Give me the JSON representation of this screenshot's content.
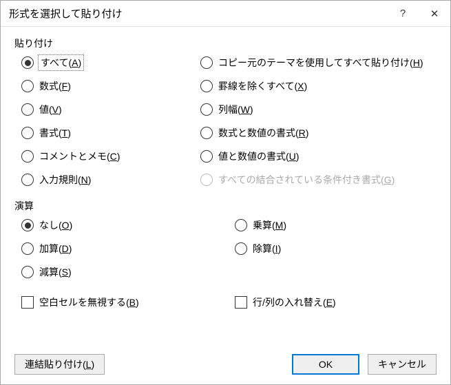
{
  "titlebar": {
    "title": "形式を選択して貼り付け",
    "help": "?",
    "close": "✕"
  },
  "paste": {
    "groupLabel": "貼り付け",
    "left": [
      {
        "text": "すべて",
        "accel": "A",
        "checked": true,
        "focused": true
      },
      {
        "text": "数式",
        "accel": "F"
      },
      {
        "text": "値",
        "accel": "V"
      },
      {
        "text": "書式",
        "accel": "T"
      },
      {
        "text": "コメントとメモ",
        "accel": "C"
      },
      {
        "text": "入力規則",
        "accel": "N"
      }
    ],
    "right": [
      {
        "text": "コピー元のテーマを使用してすべて貼り付け",
        "accel": "H"
      },
      {
        "text": "罫線を除くすべて",
        "accel": "X"
      },
      {
        "text": "列幅",
        "accel": "W"
      },
      {
        "text": "数式と数値の書式",
        "accel": "R"
      },
      {
        "text": "値と数値の書式",
        "accel": "U"
      },
      {
        "text": "すべての結合されている条件付き書式",
        "accel": "G",
        "disabled": true
      }
    ]
  },
  "operation": {
    "groupLabel": "演算",
    "left": [
      {
        "text": "なし",
        "accel": "O",
        "checked": true
      },
      {
        "text": "加算",
        "accel": "D"
      },
      {
        "text": "減算",
        "accel": "S"
      }
    ],
    "right": [
      {
        "text": "乗算",
        "accel": "M"
      },
      {
        "text": "除算",
        "accel": "I"
      }
    ]
  },
  "checkboxes": {
    "skipBlanks": {
      "text": "空白セルを無視する",
      "accel": "B"
    },
    "transpose": {
      "text": "行/列の入れ替え",
      "accel": "E"
    }
  },
  "buttons": {
    "pasteLink": {
      "text": "連結貼り付け",
      "accel": "L"
    },
    "ok": "OK",
    "cancel": "キャンセル"
  }
}
